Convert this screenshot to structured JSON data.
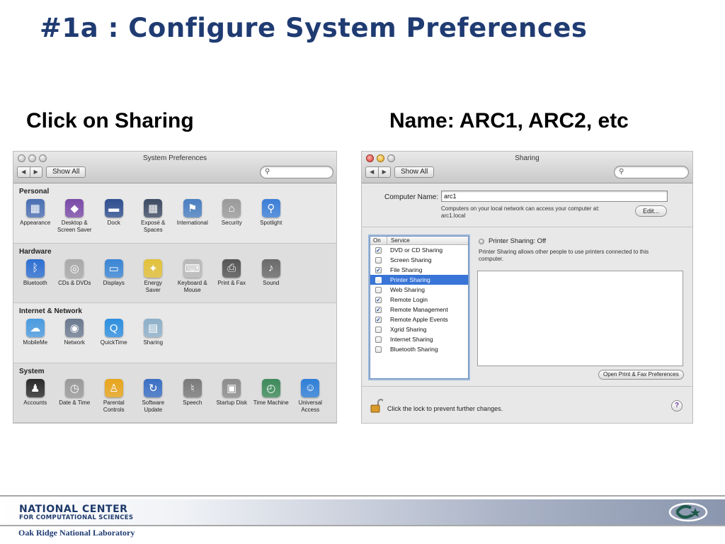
{
  "slide": {
    "title": "#1a : Configure System Preferences",
    "caption_left": "Click on Sharing",
    "caption_right": "Name: ARC1, ARC2, etc"
  },
  "sysprefs": {
    "window_title": "System Preferences",
    "back": "◀",
    "forward": "▶",
    "show_all": "Show All",
    "search_icon": "magnifier-icon",
    "sections": [
      {
        "title": "Personal",
        "items": [
          {
            "label": "Appearance",
            "icon": "appearance-icon",
            "glyph": "▦",
            "color": "#4a6fb3"
          },
          {
            "label": "Desktop &\nScreen Saver",
            "icon": "desktop-icon",
            "glyph": "◆",
            "color": "#7b4aa8"
          },
          {
            "label": "Dock",
            "icon": "dock-icon",
            "glyph": "▬",
            "color": "#2f4f8f"
          },
          {
            "label": "Exposé &\nSpaces",
            "icon": "expose-icon",
            "glyph": "▦",
            "color": "#3d4b63"
          },
          {
            "label": "International",
            "icon": "international-icon",
            "glyph": "⚑",
            "color": "#4a7fc1"
          },
          {
            "label": "Security",
            "icon": "security-icon",
            "glyph": "⌂",
            "color": "#9a9a9a"
          },
          {
            "label": "Spotlight",
            "icon": "spotlight-icon",
            "glyph": "⚲",
            "color": "#3b7ed8"
          }
        ]
      },
      {
        "title": "Hardware",
        "items": [
          {
            "label": "Bluetooth",
            "icon": "bluetooth-icon",
            "glyph": "ᛒ",
            "color": "#2d6fd2"
          },
          {
            "label": "CDs & DVDs",
            "icon": "cd-icon",
            "glyph": "◎",
            "color": "#a9a9a9"
          },
          {
            "label": "Displays",
            "icon": "displays-icon",
            "glyph": "▭",
            "color": "#3a86d6"
          },
          {
            "label": "Energy\nSaver",
            "icon": "energy-saver-icon",
            "glyph": "✦",
            "color": "#e2c13a"
          },
          {
            "label": "Keyboard &\nMouse",
            "icon": "keyboard-mouse-icon",
            "glyph": "⌨",
            "color": "#b8b8b8"
          },
          {
            "label": "Print & Fax",
            "icon": "printer-icon",
            "glyph": "⎙",
            "color": "#555555"
          },
          {
            "label": "Sound",
            "icon": "speaker-icon",
            "glyph": "♪",
            "color": "#6a6a6a"
          }
        ]
      },
      {
        "title": "Internet & Network",
        "items": [
          {
            "label": "MobileMe",
            "icon": "mobileme-icon",
            "glyph": "☁",
            "color": "#4a9be0"
          },
          {
            "label": "Network",
            "icon": "network-icon",
            "glyph": "◉",
            "color": "#6c7a90"
          },
          {
            "label": "QuickTime",
            "icon": "quicktime-icon",
            "glyph": "Q",
            "color": "#2d8fe0"
          },
          {
            "label": "Sharing",
            "icon": "sharing-folder-icon",
            "glyph": "▤",
            "color": "#8eb0c9"
          }
        ]
      },
      {
        "title": "System",
        "items": [
          {
            "label": "Accounts",
            "icon": "accounts-icon",
            "glyph": "♟",
            "color": "#2b2b2b"
          },
          {
            "label": "Date & Time",
            "icon": "clock-icon",
            "glyph": "◷",
            "color": "#9a9a9a"
          },
          {
            "label": "Parental\nControls",
            "icon": "parental-controls-icon",
            "glyph": "♙",
            "color": "#e8a51c"
          },
          {
            "label": "Software\nUpdate",
            "icon": "software-update-icon",
            "glyph": "↻",
            "color": "#3a6fc4"
          },
          {
            "label": "Speech",
            "icon": "microphone-icon",
            "glyph": "♮",
            "color": "#7a7a7a"
          },
          {
            "label": "Startup Disk",
            "icon": "startup-disk-icon",
            "glyph": "▣",
            "color": "#8c8c8c"
          },
          {
            "label": "Time Machine",
            "icon": "time-machine-icon",
            "glyph": "◴",
            "color": "#3d8a5a"
          },
          {
            "label": "Universal\nAccess",
            "icon": "universal-access-icon",
            "glyph": "☺",
            "color": "#2f7fd8"
          }
        ]
      }
    ]
  },
  "sharing": {
    "window_title": "Sharing",
    "back": "◀",
    "forward": "▶",
    "show_all": "Show All",
    "computer_name_label": "Computer Name:",
    "computer_name_value": "arc1",
    "computer_name_note": "Computers on your local network can access your computer at:\narc1.local",
    "edit_button": "Edit...",
    "col_on": "On",
    "col_service": "Service",
    "services": [
      {
        "name": "DVD or CD Sharing",
        "on": true
      },
      {
        "name": "Screen Sharing",
        "on": false
      },
      {
        "name": "File Sharing",
        "on": true
      },
      {
        "name": "Printer Sharing",
        "on": false
      },
      {
        "name": "Web Sharing",
        "on": false
      },
      {
        "name": "Remote Login",
        "on": true
      },
      {
        "name": "Remote Management",
        "on": true
      },
      {
        "name": "Remote Apple Events",
        "on": true
      },
      {
        "name": "Xgrid Sharing",
        "on": false
      },
      {
        "name": "Internet Sharing",
        "on": false
      },
      {
        "name": "Bluetooth Sharing",
        "on": false
      }
    ],
    "selected_service": "Printer Sharing",
    "status": "Printer Sharing: Off",
    "description": "Printer Sharing allows other people to use printers connected to this computer.",
    "open_prefs_button": "Open Print & Fax Preferences",
    "lock_text": "Click the lock to prevent further changes.",
    "help": "?",
    "check_mark": "✓"
  },
  "footer": {
    "brand_line1": "NATIONAL CENTER",
    "brand_line2": "FOR COMPUTATIONAL SCIENCES",
    "org": "Oak Ridge National Laboratory"
  },
  "colors": {
    "title_blue": "#1f3b72",
    "selection": "#3875d7"
  }
}
